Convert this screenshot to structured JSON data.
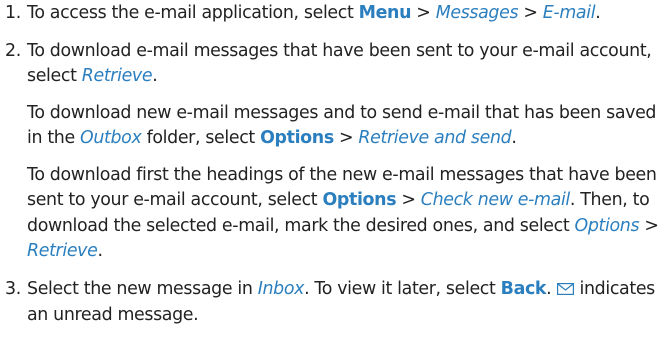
{
  "steps": [
    {
      "number": "1.",
      "paragraphs": [
        {
          "t1": "To access the e-mail application, select ",
          "m1": "Menu",
          "s1": " > ",
          "o1": "Messages",
          "s2": " > ",
          "o2": "E-mail",
          "t2": "."
        }
      ]
    },
    {
      "number": "2.",
      "p1": {
        "t1": "To download e-mail messages that have been sent to your e-mail account, select ",
        "o1": "Retrieve",
        "t2": "."
      },
      "p2": {
        "t1": "To download new e-mail messages and to send e-mail that has been saved in the ",
        "o1": "Outbox",
        "t2": " folder, select ",
        "m1": "Options",
        "s1": " > ",
        "o2": "Retrieve and send",
        "t3": "."
      },
      "p3": {
        "t1": "To download first the headings of the new e-mail messages that have been sent to your e-mail account, select ",
        "m1": "Options",
        "s1": " > ",
        "o1": "Check new e-mail",
        "t2": ". Then, to download the selected e-mail, mark the desired ones, and select ",
        "o2": "Options",
        "s2": " > ",
        "o3": "Retrieve",
        "t3": "."
      }
    },
    {
      "number": "3.",
      "p1": {
        "t1": "Select the new message in ",
        "o1": "Inbox",
        "t2": ". To view it later, select ",
        "m1": "Back",
        "t3": ".",
        "icon": "envelope-icon",
        "t4": "indicates an unread message."
      }
    }
  ],
  "colors": {
    "link": "#2b7fbf",
    "text": "#222222"
  }
}
